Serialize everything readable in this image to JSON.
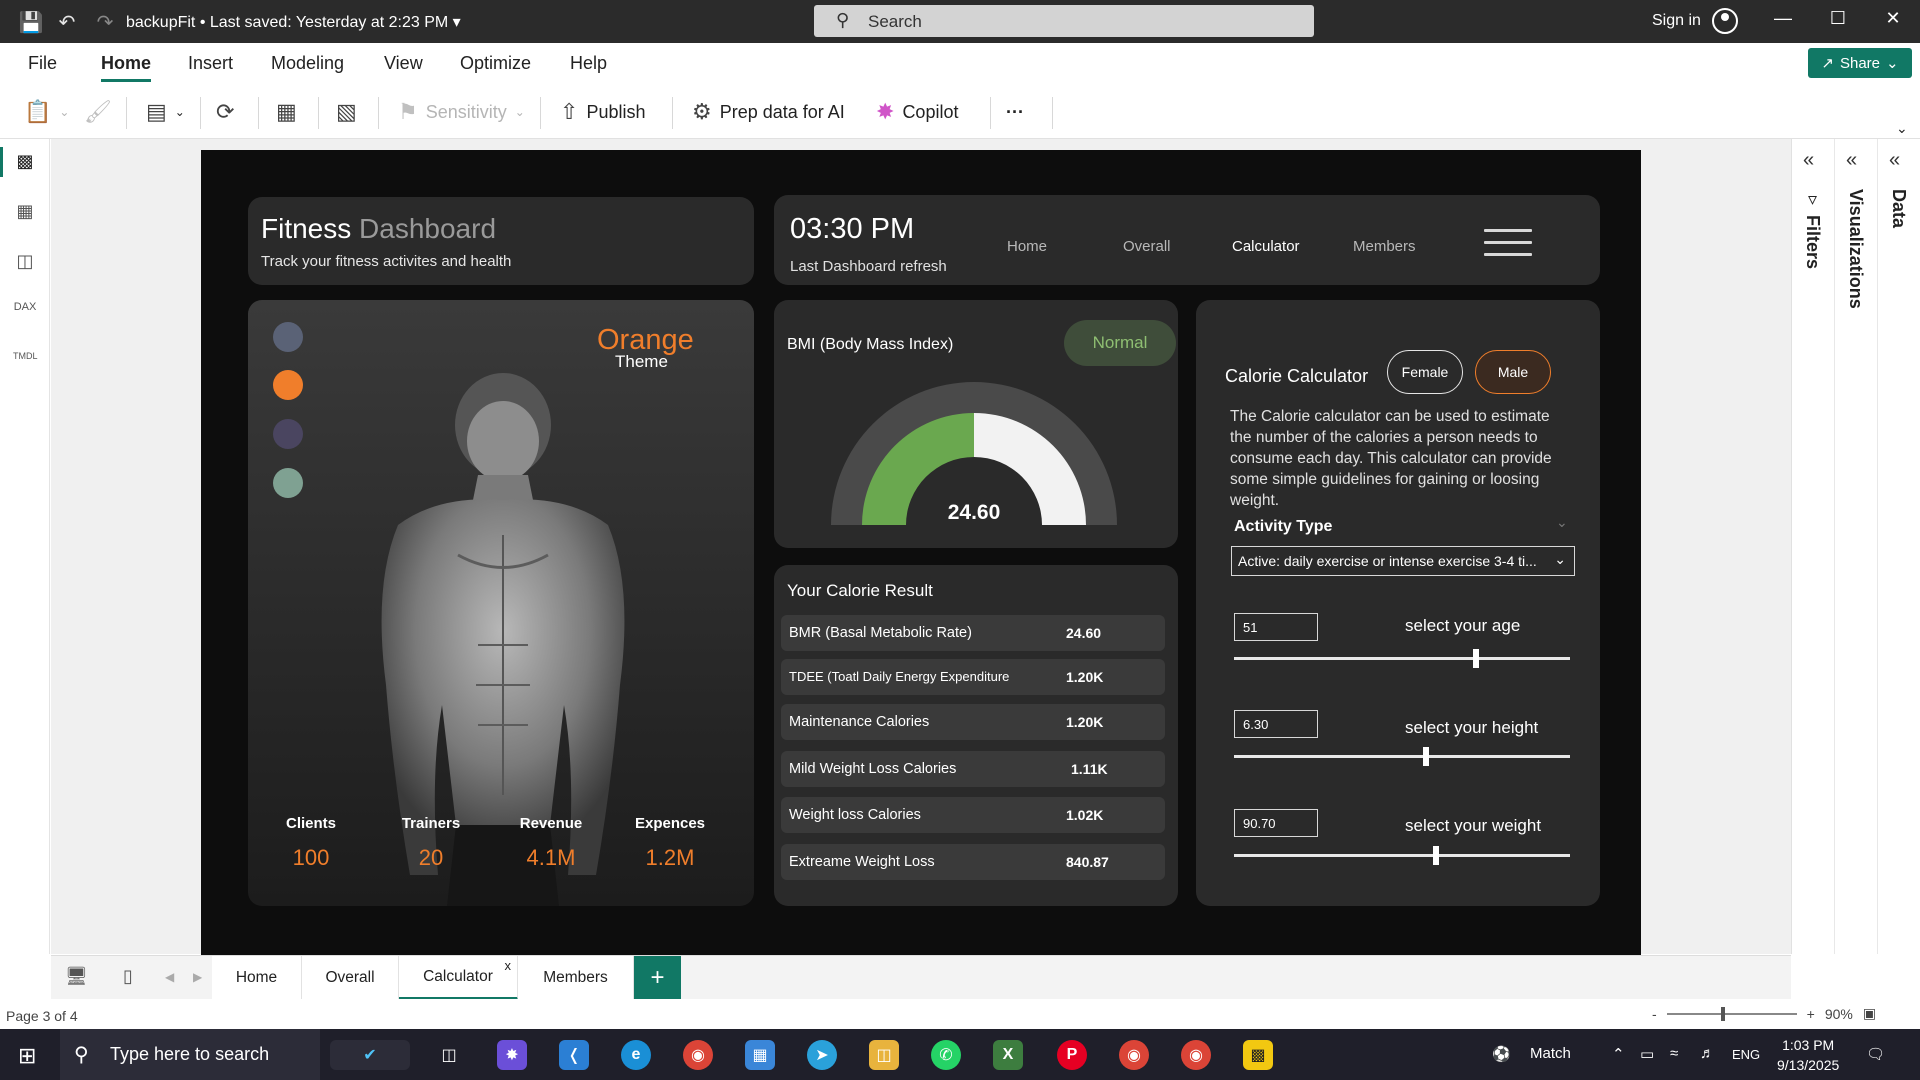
{
  "titlebar": {
    "doc_title": "backupFit  •  Last saved: Yesterday at 2:23 PM",
    "search_placeholder": "Search",
    "sign_in": "Sign in"
  },
  "menu": {
    "tabs": [
      "File",
      "Home",
      "Insert",
      "Modeling",
      "View",
      "Optimize",
      "Help"
    ],
    "active": "Home",
    "share": "Share"
  },
  "ribbon": {
    "sensitivity": "Sensitivity",
    "publish": "Publish",
    "prep_data": "Prep data for AI",
    "copilot": "Copilot",
    "more": "···"
  },
  "report": {
    "header": {
      "title_main": "Fitness",
      "title_accent": "Dashboard",
      "subtitle": "Track your fitness activites and health"
    },
    "nav": {
      "time": "03:30 PM",
      "refresh_label": "Last Dashboard refresh",
      "links": [
        "Home",
        "Overall",
        "Calculator",
        "Members"
      ],
      "active": "Calculator"
    },
    "theme": {
      "name": "Orange",
      "sub": "Theme",
      "dots": [
        "#5a6276",
        "#f07e2b",
        "#4a4560",
        "#7fa192"
      ]
    },
    "kpis": [
      {
        "label": "Clients",
        "value": "100"
      },
      {
        "label": "Trainers",
        "value": "20"
      },
      {
        "label": "Revenue",
        "value": "4.1M"
      },
      {
        "label": "Expences",
        "value": "1.2M"
      }
    ],
    "bmi": {
      "title": "BMI (Body Mass Index)",
      "status": "Normal",
      "value": "24.60",
      "gauge_fraction": 0.5,
      "colors": {
        "filled": "#6aa84f",
        "remaining": "#f2f2f2",
        "track": "#4a4a4a"
      }
    },
    "results": {
      "title": "Your Calorie  Result",
      "rows": [
        {
          "label": "BMR (Basal Metabolic Rate)",
          "value": "24.60"
        },
        {
          "label": "TDEE (Toatl Daily Energy Expenditure",
          "value": "1.20K"
        },
        {
          "label": "Maintenance Calories",
          "value": "1.20K"
        },
        {
          "label": "Mild Weight Loss Calories",
          "value": "1.11K"
        },
        {
          "label": "Weight loss Calories",
          "value": "1.02K"
        },
        {
          "label": "Extreame Weight Loss",
          "value": "840.87"
        }
      ]
    },
    "calculator": {
      "title": "Calorie  Calculator",
      "female": "Female",
      "male": "Male",
      "description": "The Calorie calculator can be used to estimate the number of the calories a person needs to consume each day. This calculator can provide some simple guidelines for gaining or loosing weight.",
      "activity_label": "Activity Type",
      "activity_value": "Active: daily exercise or intense exercise 3-4 ti...",
      "age": {
        "value": "51",
        "caption": "select your age",
        "slider_fraction": 0.72
      },
      "height": {
        "value": "6.30",
        "caption": "select your height",
        "slider_fraction": 0.57
      },
      "weight": {
        "value": "90.70",
        "caption": "select your weight",
        "slider_fraction": 0.6
      }
    }
  },
  "pages": {
    "tabs": [
      "Home",
      "Overall",
      "Calculator",
      "Members"
    ],
    "active": "Calculator",
    "close": "x",
    "add": "+"
  },
  "panes": {
    "filters": "Filters",
    "visualizations": "Visualizations",
    "data": "Data"
  },
  "status": {
    "page_info": "Page 3 of 4",
    "zoom": "90%"
  },
  "taskbar": {
    "search_placeholder": "Type here to search",
    "weather": "Match",
    "lang": "ENG",
    "time": "1:03 PM",
    "date": "9/13/2025"
  }
}
